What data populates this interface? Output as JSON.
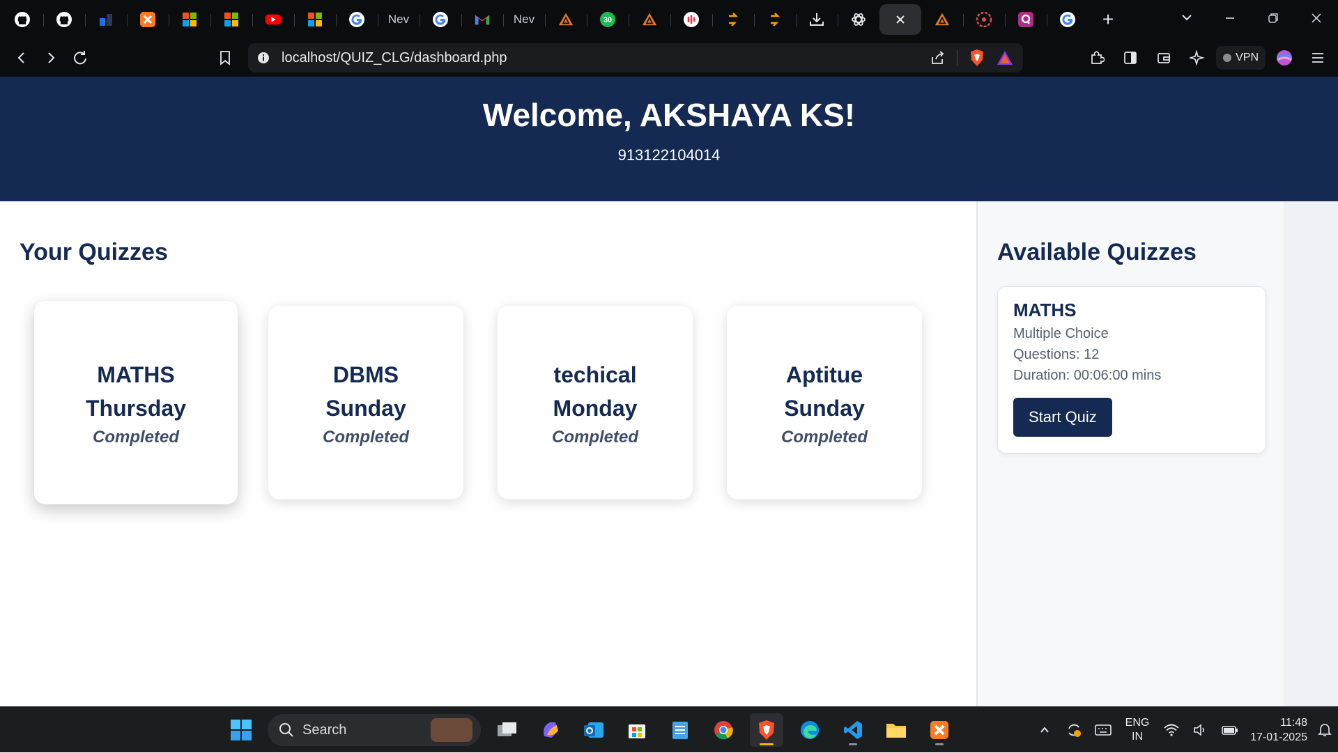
{
  "browser": {
    "tabs": [
      {
        "icon": "github-icon",
        "label": "",
        "color": "#ffffff"
      },
      {
        "icon": "github-icon",
        "label": "",
        "color": "#ffffff"
      },
      {
        "icon": "dashboard-icon",
        "label": "",
        "color": "#1f6feb"
      },
      {
        "icon": "xampp-icon",
        "label": "",
        "color": "#fb7a24"
      },
      {
        "icon": "microsoft-icon",
        "label": "",
        "color": "#f25022"
      },
      {
        "icon": "microsoft-icon",
        "label": "",
        "color": "#f25022"
      },
      {
        "icon": "youtube-icon",
        "label": "",
        "color": "#ff0000"
      },
      {
        "icon": "microsoft-icon",
        "label": "",
        "color": "#f25022"
      },
      {
        "icon": "google-icon",
        "label": "",
        "color": "#4285f4"
      },
      {
        "icon": "",
        "label": "Nev",
        "color": ""
      },
      {
        "icon": "google-icon",
        "label": "",
        "color": "#4285f4"
      },
      {
        "icon": "gmail-icon",
        "label": "",
        "color": "#ea4335"
      },
      {
        "icon": "",
        "label": "Nev",
        "color": ""
      },
      {
        "icon": "sail-icon",
        "label": "",
        "color": "#e07a2e"
      },
      {
        "icon": "badge-30-icon",
        "label": "",
        "color": "#1db954"
      },
      {
        "icon": "sail-icon",
        "label": "",
        "color": "#e07a2e"
      },
      {
        "icon": "podcast-icon",
        "label": "",
        "color": "#e8364a"
      },
      {
        "icon": "arrow-icon",
        "label": "",
        "color": "#f4a300"
      },
      {
        "icon": "arrow-icon",
        "label": "",
        "color": "#f4a300"
      },
      {
        "icon": "download-icon",
        "label": "",
        "color": "#e4e6ea"
      },
      {
        "icon": "openai-icon",
        "label": "",
        "color": "#e4e6ea"
      },
      {
        "icon": "close-icon",
        "label": "",
        "color": "#e4e6ea",
        "active": true
      },
      {
        "icon": "sail-icon",
        "label": "",
        "color": "#e07a2e"
      },
      {
        "icon": "compass-icon",
        "label": "",
        "color": "#e34b4b"
      },
      {
        "icon": "q-icon",
        "label": "",
        "color": "#b02a8a"
      },
      {
        "icon": "google-icon",
        "label": "",
        "color": "#4285f4"
      }
    ],
    "url": "localhost/QUIZ_CLG/dashboard.php",
    "vpn_label": "VPN"
  },
  "header": {
    "welcome": "Welcome, AKSHAYA KS!",
    "roll_number": "913122104014"
  },
  "your_quizzes": {
    "title": "Your Quizzes",
    "cards": [
      {
        "name": "MATHS",
        "day": "Thursday",
        "status": "Completed"
      },
      {
        "name": "DBMS",
        "day": "Sunday",
        "status": "Completed"
      },
      {
        "name": "techical",
        "day": "Monday",
        "status": "Completed"
      },
      {
        "name": "Aptitue",
        "day": "Sunday",
        "status": "Completed"
      }
    ]
  },
  "available_quizzes": {
    "title": "Available Quizzes",
    "items": [
      {
        "name": "MATHS",
        "type": "Multiple Choice",
        "questions": "Questions: 12",
        "duration": "Duration: 00:06:00 mins",
        "button": "Start Quiz"
      }
    ]
  },
  "taskbar": {
    "search_label": "Search",
    "lang_line1": "ENG",
    "lang_line2": "IN",
    "time": "11:48",
    "date": "17-01-2025"
  },
  "colors": {
    "header_bg": "#142a52",
    "accent": "#142a52",
    "status_text": "#3e4d66"
  }
}
